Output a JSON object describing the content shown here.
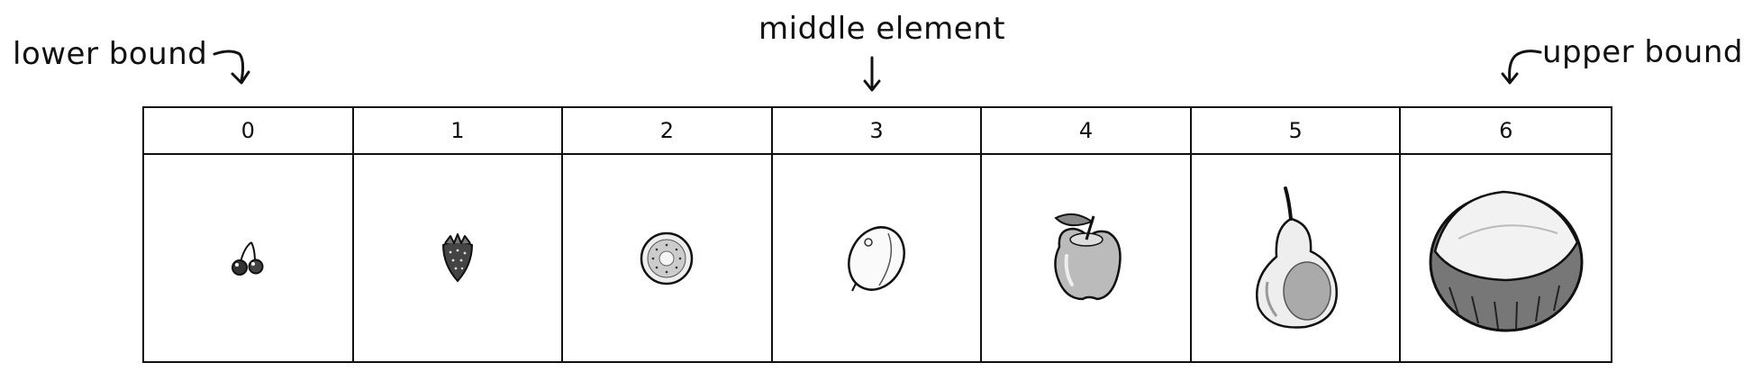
{
  "annotations": {
    "lower": "lower bound",
    "middle": "middle element",
    "upper": "upper bound"
  },
  "array": {
    "indices": [
      "0",
      "1",
      "2",
      "3",
      "4",
      "5",
      "6"
    ],
    "items": [
      {
        "icon": "cherries-icon"
      },
      {
        "icon": "strawberry-icon"
      },
      {
        "icon": "kiwi-icon"
      },
      {
        "icon": "lemon-icon"
      },
      {
        "icon": "apple-icon"
      },
      {
        "icon": "pear-icon"
      },
      {
        "icon": "coconut-icon"
      }
    ]
  },
  "colors": {
    "ink": "#111111",
    "background": "#ffffff"
  }
}
